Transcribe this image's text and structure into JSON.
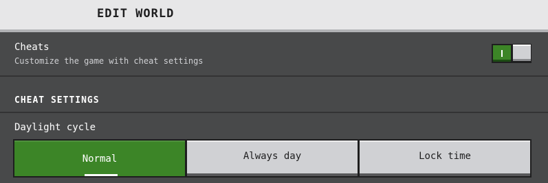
{
  "header": {
    "title": "EDIT WORLD"
  },
  "cheats": {
    "label": "Cheats",
    "description": "Customize the game with cheat settings",
    "toggle_on": true,
    "toggle_glyph": "I"
  },
  "cheat_settings": {
    "heading": "CHEAT SETTINGS",
    "daylight_cycle": {
      "label": "Daylight cycle",
      "options": [
        "Normal",
        "Always day",
        "Lock time"
      ],
      "selected": "Normal"
    }
  },
  "colors": {
    "accent_green": "#3c8527",
    "panel_bg": "#48494a",
    "header_bg": "#e7e7e8",
    "button_bg": "#d0d1d4"
  }
}
